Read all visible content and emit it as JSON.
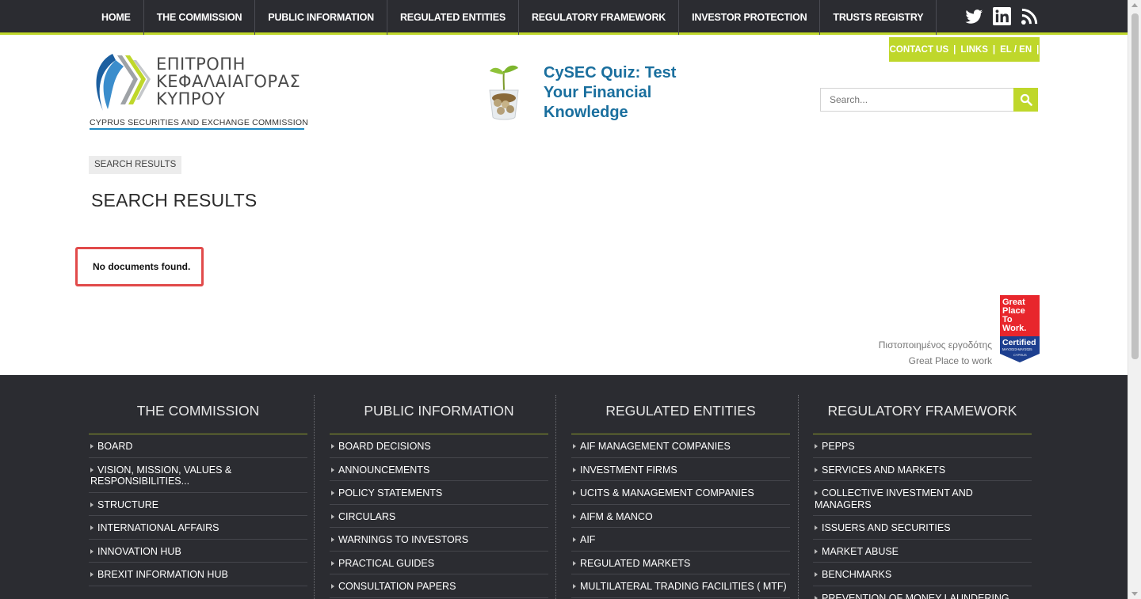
{
  "nav": {
    "items": [
      "HOME",
      "THE COMMISSION",
      "PUBLIC INFORMATION",
      "REGULATED ENTITIES",
      "REGULATORY FRAMEWORK",
      "INVESTOR PROTECTION",
      "TRUSTS REGISTRY"
    ],
    "social": [
      "twitter-icon",
      "linkedin-icon",
      "rss-icon"
    ]
  },
  "contact_bar": {
    "contact": "CONTACT US",
    "links": "LINKS",
    "lang": "EL / EN",
    "sep": "|"
  },
  "logo": {
    "line1": "ΕΠΙΤΡΟΠΗ",
    "line2": "ΚΕΦΑΛΑΙΑΓΟΡΑΣ",
    "line3": "ΚΥΠΡΟΥ",
    "english": "CYPRUS SECURITIES AND EXCHANGE COMMISSION"
  },
  "quiz": {
    "title": "CySEC Quiz: Test Your Financial Knowledge"
  },
  "search": {
    "placeholder": "Search..."
  },
  "breadcrumb": "SEARCH RESULTS",
  "page_title": "SEARCH RESULTS",
  "notice": "No documents found.",
  "gptw": {
    "line1": "Πιστοποιημένος εργοδότης",
    "line2": "Great Place to work",
    "badge": {
      "top": "Great Place To Work.",
      "certified": "Certified",
      "dates": "MAY2023-MAY2025",
      "country": "CYPRUS"
    }
  },
  "footer": {
    "columns": [
      {
        "title": "THE COMMISSION",
        "items": [
          "BOARD",
          "VISION, MISSION, VALUES & RESPONSIBILITIES...",
          "STRUCTURE",
          "INTERNATIONAL AFFAIRS",
          "INNOVATION HUB",
          "BREXIT INFORMATION HUB"
        ]
      },
      {
        "title": "PUBLIC INFORMATION",
        "items": [
          "BOARD DECISIONS",
          "ANNOUNCEMENTS",
          "POLICY STATEMENTS",
          "CIRCULARS",
          "WARNINGS TO INVESTORS",
          "PRACTICAL GUIDES",
          "CONSULTATION PAPERS"
        ]
      },
      {
        "title": "REGULATED ENTITIES",
        "items": [
          "AIF MANAGEMENT COMPANIES",
          "INVESTMENT FIRMS",
          "UCITS & MANAGEMENT COMPANIES",
          "AIFM & MANCO",
          "AIF",
          "REGULATED MARKETS",
          "MULTILATERAL TRADING FACILITIES ( MTF)"
        ]
      },
      {
        "title": "REGULATORY FRAMEWORK",
        "items": [
          "PEPPS",
          "SERVICES AND MARKETS",
          "COLLECTIVE INVESTMENT AND MANAGERS",
          "ISSUERS AND SECURITIES",
          "MARKET ABUSE",
          "BENCHMARKS",
          "PREVENTION OF MONEY LAUNDERING AND"
        ]
      }
    ]
  },
  "colors": {
    "dark": "#2b2c31",
    "accent": "#bfd72b",
    "link_blue": "#1a6f9e",
    "notice_border": "#e14a4a"
  }
}
